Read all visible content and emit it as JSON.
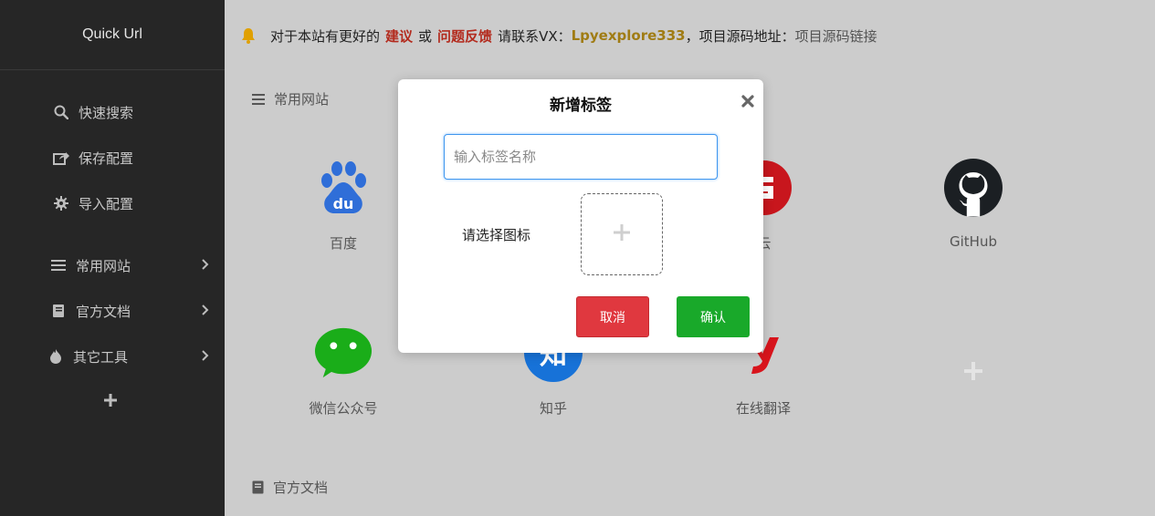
{
  "sidebar": {
    "brand": "Quick Url",
    "items": [
      {
        "label": "快速搜索",
        "icon": "search-icon"
      },
      {
        "label": "保存配置",
        "icon": "share-icon"
      },
      {
        "label": "导入配置",
        "icon": "gear-icon"
      },
      {
        "label": "常用网站",
        "icon": "list-icon"
      },
      {
        "label": "官方文档",
        "icon": "book-icon"
      },
      {
        "label": "其它工具",
        "icon": "flame-icon"
      }
    ],
    "add_icon": "plus-icon"
  },
  "notice": {
    "prefix": "对于本站有更好的",
    "suggestion": "建议",
    "or": "或",
    "feedback": "问题反馈",
    "contact": "请联系VX：",
    "wechat": "Lpyexplore333",
    "source_prefix": "，项目源码地址：",
    "source_link": "项目源码链接"
  },
  "sections": {
    "common_sites": "常用网站",
    "official_docs": "官方文档"
  },
  "tiles": [
    {
      "name": "百度",
      "icon": "baidu-icon"
    },
    {
      "name": "云",
      "icon": "aliyun-icon"
    },
    {
      "name": "GitHub",
      "icon": "github-icon"
    },
    {
      "name": "微信公众号",
      "icon": "wechat-icon"
    },
    {
      "name": "知乎",
      "icon": "zhihu-icon"
    },
    {
      "name": "在线翻译",
      "icon": "youdao-icon"
    }
  ],
  "modal": {
    "title": "新增标签",
    "input_placeholder": "输入标签名称",
    "icon_label": "请选择图标",
    "cancel": "取消",
    "confirm": "确认"
  },
  "colors": {
    "sidebar_bg": "#262626",
    "accent_red": "#b32b1e",
    "accent_gold": "#a07c14",
    "cancel_red": "#e0383f",
    "confirm_green": "#19a92a"
  }
}
